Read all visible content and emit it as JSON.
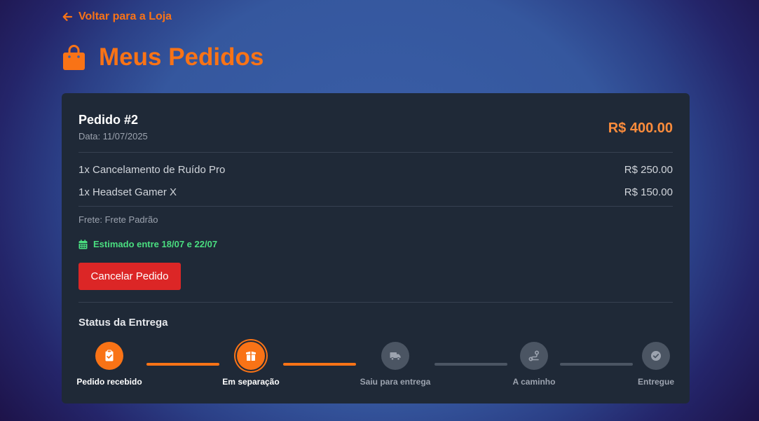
{
  "header": {
    "back_link": "Voltar para a Loja",
    "back_icon": "arrow-left-icon",
    "title": "Meus Pedidos",
    "title_icon": "shopping-bag-icon"
  },
  "order": {
    "number": "Pedido #2",
    "date": "Data: 11/07/2025",
    "total": "R$ 400.00",
    "items": [
      {
        "description": "1x Cancelamento de Ruído Pro",
        "price": "R$ 250.00"
      },
      {
        "description": "1x Headset Gamer X",
        "price": "R$ 150.00"
      }
    ],
    "shipping": "Frete: Frete Padrão",
    "estimate": "Estimado entre 18/07 e 22/07",
    "cancel_label": "Cancelar Pedido"
  },
  "delivery_status": {
    "title": "Status da Entrega",
    "steps": [
      {
        "label": "Pedido recebido",
        "state": "done",
        "icon": "clipboard-check-icon"
      },
      {
        "label": "Em separação",
        "state": "current",
        "icon": "box-open-icon"
      },
      {
        "label": "Saiu para entrega",
        "state": "pending",
        "icon": "truck-icon"
      },
      {
        "label": "A caminho",
        "state": "pending",
        "icon": "route-icon"
      },
      {
        "label": "Entregue",
        "state": "pending",
        "icon": "check-circle-icon"
      }
    ]
  },
  "colors": {
    "accent": "#f97316",
    "card": "#1f2937",
    "success": "#4ade80",
    "danger": "#dc2626"
  }
}
